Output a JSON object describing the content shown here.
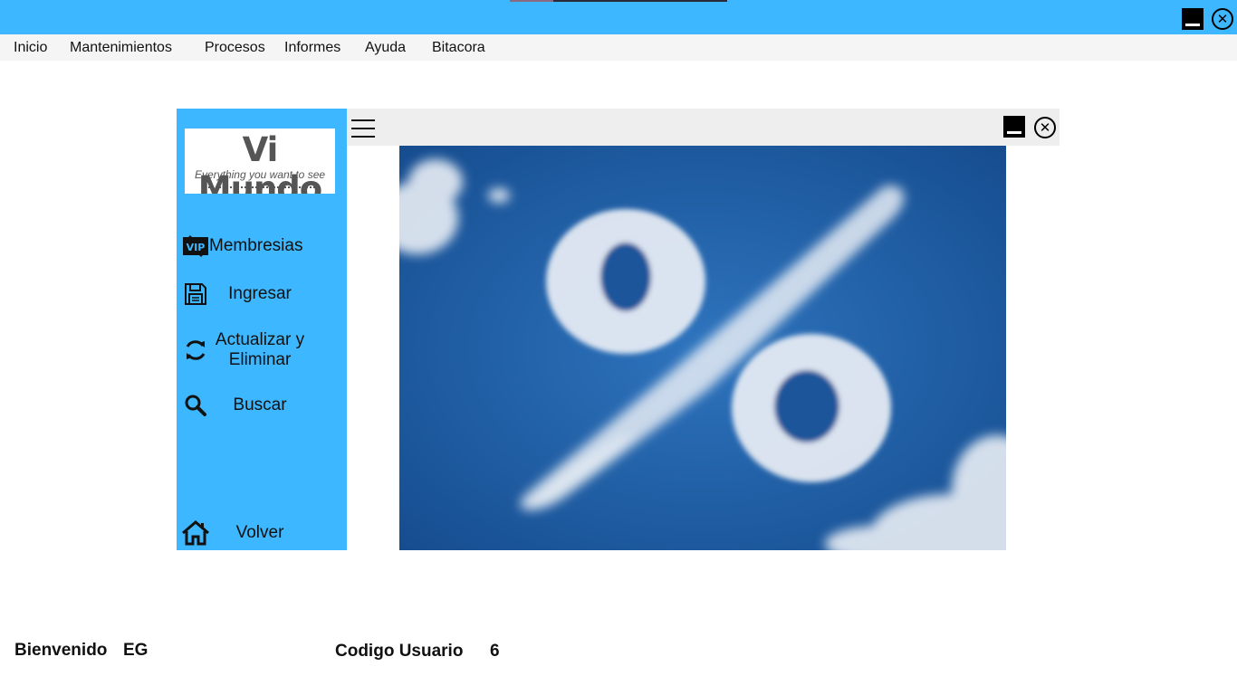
{
  "menu": {
    "items": [
      "Inicio",
      "Mantenimientos",
      "Procesos",
      "Informes",
      "Ayuda",
      "Bitacora"
    ]
  },
  "logo": {
    "title": "Vi Mundo",
    "subtitle": "Everything you want to see"
  },
  "sidebar": {
    "items": [
      {
        "label": "Membresias",
        "icon": "vip-icon"
      },
      {
        "label": "Ingresar",
        "icon": "save-icon"
      },
      {
        "label": "Actualizar y Eliminar",
        "icon": "refresh-icon"
      },
      {
        "label": "Buscar",
        "icon": "search-icon"
      },
      {
        "label": "Volver",
        "icon": "home-icon"
      }
    ]
  },
  "footer": {
    "welcome_label": "Bienvenido",
    "welcome_user": "EG",
    "code_label": "Codigo Usuario",
    "code_value": "6"
  },
  "colors": {
    "accent": "#3db7ff",
    "menubar": "#f5f5f5",
    "inner_bar": "#eeeeee",
    "sky": "#1a5aa0"
  }
}
